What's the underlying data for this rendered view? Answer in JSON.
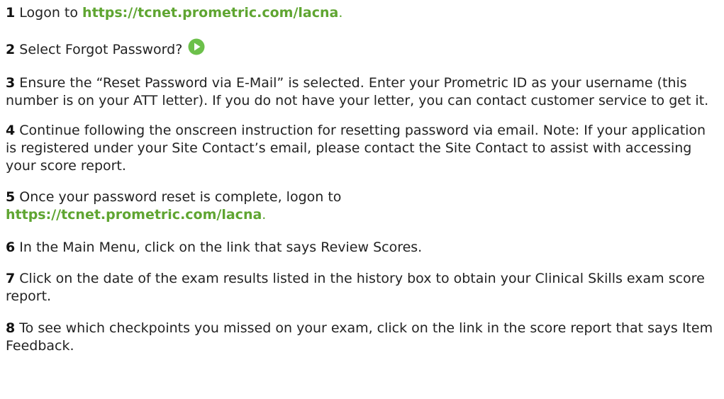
{
  "colors": {
    "link": "#5fa531",
    "text": "#222222",
    "play_icon_fill": "#6cc04a"
  },
  "steps": [
    {
      "num": "1",
      "before": "Logon to ",
      "link": "https://tcnet.prometric.com/lacna",
      "after": "."
    },
    {
      "num": "2",
      "text": "Select Forgot Password?",
      "icon": "play-icon"
    },
    {
      "num": "3",
      "text": "Ensure the “Reset Password via E-Mail” is selected. Enter your Prometric ID as your username (this number is on your ATT letter). If you do not have your letter, you can contact customer service to get it."
    },
    {
      "num": "4",
      "text": "Continue following the onscreen instruction for resetting password via email. Note: If your application is registered under your Site Contact’s email, please contact the Site Contact to assist with accessing your score report."
    },
    {
      "num": "5",
      "before": "Once your password reset is complete, logon to ",
      "link": "https://tcnet.prometric.com/lacna",
      "after": "."
    },
    {
      "num": "6",
      "text": "In the Main Menu, click on the link that says Review Scores."
    },
    {
      "num": "7",
      "text": "Click on the date of the exam results listed in the history box to obtain your Clinical Skills exam score report."
    },
    {
      "num": "8",
      "text": "To see which checkpoints you missed on your exam, click on the link in the score report that says Item Feedback."
    }
  ]
}
